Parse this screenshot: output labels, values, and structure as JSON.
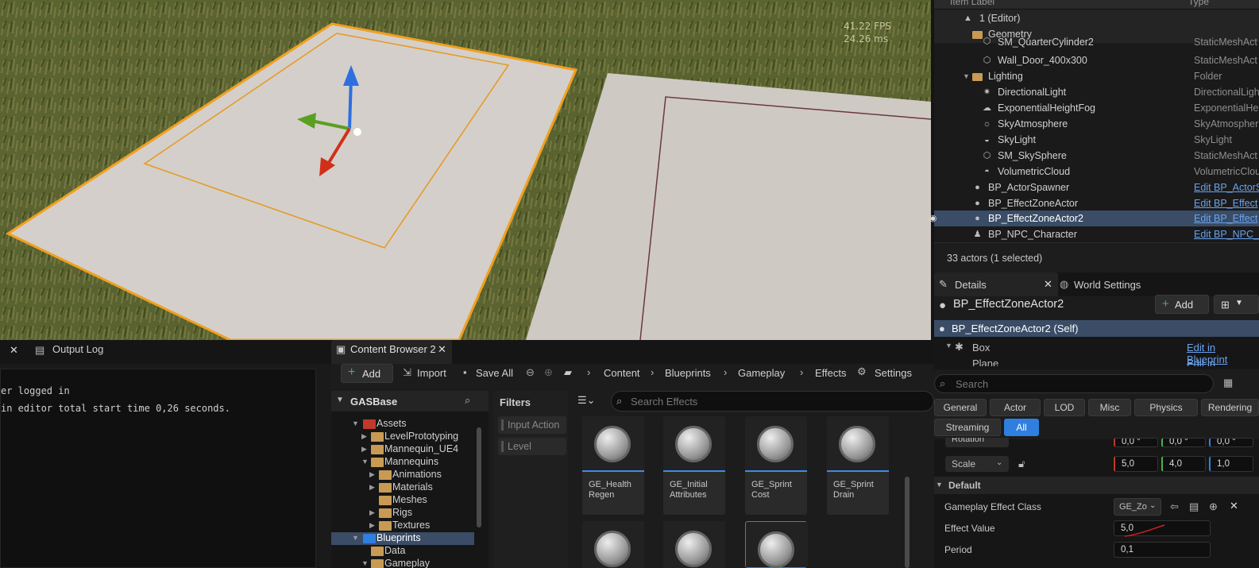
{
  "viewport": {
    "fps": "41.22 FPS",
    "ms": "24.26 ms"
  },
  "outliner": {
    "header_label": "Item Label",
    "header_type": "Type",
    "rows": [
      {
        "label": "1 (Editor)",
        "type": "",
        "icon": "level-icon"
      },
      {
        "label": "Geometry",
        "type": "",
        "icon": "folder-icon"
      },
      {
        "label": "SM_QuarterCylinder2",
        "type": "StaticMeshAct",
        "icon": "mesh-icon"
      },
      {
        "label": "Wall_Door_400x300",
        "type": "StaticMeshAct",
        "icon": "mesh-icon"
      },
      {
        "label": "Lighting",
        "type": "Folder",
        "icon": "folder-icon"
      },
      {
        "label": "DirectionalLight",
        "type": "DirectionalLigh",
        "icon": "sun-icon"
      },
      {
        "label": "ExponentialHeightFog",
        "type": "ExponentialHe",
        "icon": "fog-icon"
      },
      {
        "label": "SkyAtmosphere",
        "type": "SkyAtmospher",
        "icon": "atmosphere-icon"
      },
      {
        "label": "SkyLight",
        "type": "SkyLight",
        "icon": "skylight-icon"
      },
      {
        "label": "SM_SkySphere",
        "type": "StaticMeshAct",
        "icon": "mesh-icon"
      },
      {
        "label": "VolumetricCloud",
        "type": "VolumetricClou",
        "icon": "cloud-icon"
      },
      {
        "label": "BP_ActorSpawner",
        "type": "Edit BP_ActorS",
        "icon": "actor-icon"
      },
      {
        "label": "BP_EffectZoneActor",
        "type": "Edit BP_Effect",
        "icon": "actor-icon"
      },
      {
        "label": "BP_EffectZoneActor2",
        "type": "Edit BP_Effect",
        "icon": "actor-icon"
      },
      {
        "label": "BP_NPC_Character",
        "type": "Edit BP_NPC_C",
        "icon": "pawn-icon"
      }
    ],
    "count": "33 actors (1 selected)"
  },
  "details": {
    "tab": "Details",
    "tab2": "World Settings",
    "actor": "BP_EffectZoneActor2",
    "add": "Add",
    "self_row": "BP_EffectZoneActor2 (Self)",
    "box": "Box",
    "edit_bp": "Edit in Blueprint",
    "plane": "Plane",
    "search_placeholder": "Search",
    "filters": [
      "General",
      "Actor",
      "LOD",
      "Misc",
      "Physics",
      "Rendering",
      "Streaming",
      "All"
    ],
    "rotation_label": "Rotation",
    "rotation": [
      "0,0 °",
      "0,0 °",
      "0,0 °"
    ],
    "scale_label": "Scale",
    "scale": [
      "5,0",
      "4,0",
      "1,0"
    ],
    "section": "Default",
    "gec_label": "Gameplay Effect Class",
    "gec_value": "GE_Zo",
    "effect_value_label": "Effect Value",
    "effect_value": "5,0",
    "period_label": "Period",
    "period": "0,1"
  },
  "outputlog": {
    "tab": "Output Log",
    "lines": [
      "er logged in",
      "in editor total start time 0,26 seconds."
    ]
  },
  "content_browser": {
    "tab": "Content Browser 2",
    "add": "Add",
    "import": "Import",
    "save_all": "Save All",
    "crumbs": [
      "Content",
      "Blueprints",
      "Gameplay",
      "Effects"
    ],
    "settings": "Settings",
    "root": "GASBase",
    "filters_title": "Filters",
    "filter_items": [
      "Input Action",
      "Level"
    ],
    "search_placeholder": "Search Effects",
    "tree": [
      "Assets",
      "LevelPrototyping",
      "Mannequin_UE4",
      "Mannequins",
      "Animations",
      "Materials",
      "Meshes",
      "Rigs",
      "Textures",
      "Blueprints",
      "Data",
      "Gameplay"
    ],
    "assets": [
      {
        "name": "GE_Health\nRegen"
      },
      {
        "name": "GE_Initial\nAttributes"
      },
      {
        "name": "GE_Sprint\nCost"
      },
      {
        "name": "GE_Sprint\nDrain"
      }
    ]
  },
  "colors": {
    "accent": "#2f7fe0",
    "selection_outline": "#f0a020",
    "folder": "#c89a54"
  }
}
